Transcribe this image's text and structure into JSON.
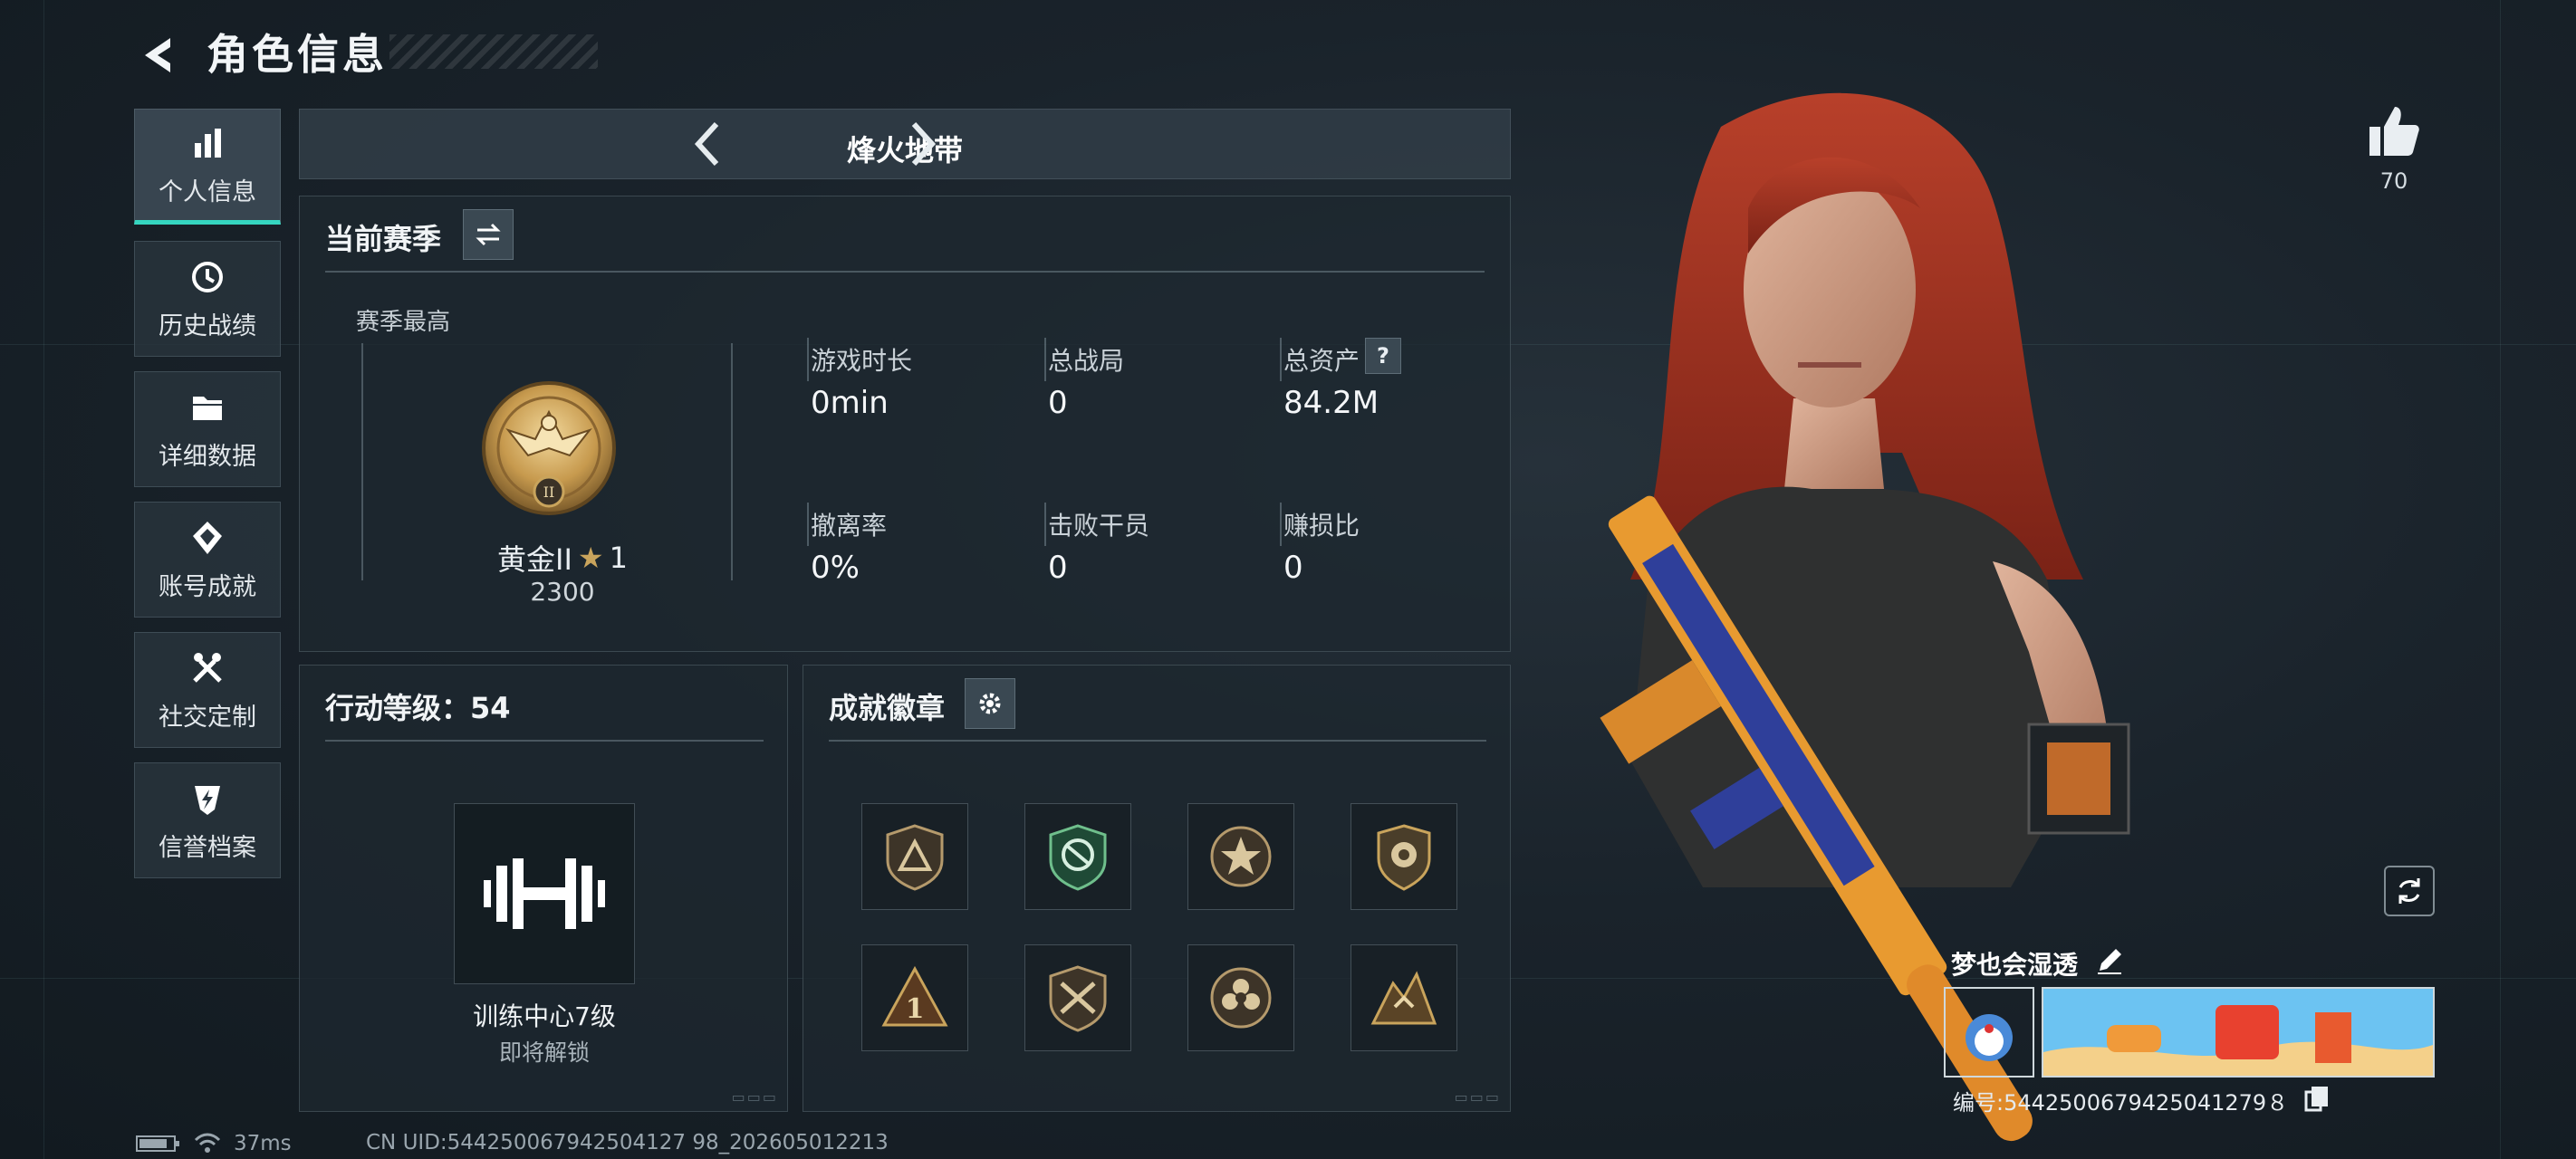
{
  "header": {
    "title": "角色信息"
  },
  "sidebar": {
    "items": [
      {
        "label": "个人信息",
        "icon": "bar-chart-icon",
        "active": true
      },
      {
        "label": "历史战绩",
        "icon": "history-icon",
        "active": false
      },
      {
        "label": "详细数据",
        "icon": "folder-icon",
        "active": false
      },
      {
        "label": "账号成就",
        "icon": "achievement-icon",
        "active": false
      },
      {
        "label": "社交定制",
        "icon": "tools-icon",
        "active": false
      },
      {
        "label": "信誉档案",
        "icon": "credit-icon",
        "active": false
      }
    ]
  },
  "mode_selector": {
    "label": "烽火地带"
  },
  "season": {
    "title": "当前赛季",
    "highest_label": "赛季最高",
    "rank_name": "黄金II",
    "rank_stars": "1",
    "rank_score": "2300",
    "stats": [
      {
        "label": "游戏时长",
        "value": "0min"
      },
      {
        "label": "总战局",
        "value": "0"
      },
      {
        "label": "总资产",
        "value": "84.2M",
        "help": "?"
      },
      {
        "label": "撤离率",
        "value": "0%"
      },
      {
        "label": "击败干员",
        "value": "0"
      },
      {
        "label": "赚损比",
        "value": "0"
      }
    ]
  },
  "level": {
    "title": "行动等级：54",
    "unlock_name": "训练中心7级",
    "unlock_status": "即将解锁"
  },
  "achievements": {
    "title": "成就徽章",
    "badges": [
      "triangle-shield-badge-icon",
      "green-emblem-badge-icon",
      "star-ring-badge-icon",
      "gold-shield-badge-icon",
      "number-one-triangle-badge-icon",
      "crossed-rifles-badge-icon",
      "flower-medal-badge-icon",
      "mountain-crest-badge-icon"
    ]
  },
  "profile": {
    "likes": "70",
    "player_name": "梦也会湿透",
    "player_id": "编号:5442500679425041279８"
  },
  "footer": {
    "ping": "37ms",
    "uid": "CN UID:544250067942504127 98_202605012213"
  },
  "colors": {
    "accent": "#35d6c0",
    "gold": "#c9a45c",
    "background": "#1a232b"
  }
}
